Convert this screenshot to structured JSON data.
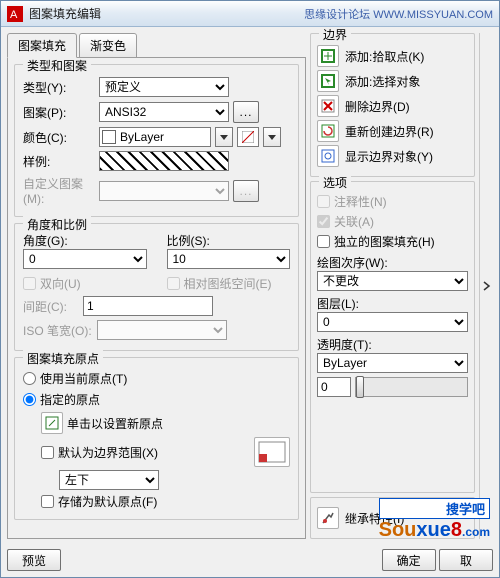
{
  "title": "图案填充编辑",
  "watermark": "思缘设计论坛 WWW.MISSYUAN.COM",
  "tabs": {
    "fill": "图案填充",
    "grad": "渐变色"
  },
  "typeGroup": {
    "title": "类型和图案",
    "type_lbl": "类型(Y):",
    "type_val": "预定义",
    "pat_lbl": "图案(P):",
    "pat_val": "ANSI32",
    "color_lbl": "颜色(C):",
    "color_val": "ByLayer",
    "sample_lbl": "样例:",
    "custom_lbl": "自定义图案(M):"
  },
  "angleGroup": {
    "title": "角度和比例",
    "angle_lbl": "角度(G):",
    "angle_val": "0",
    "scale_lbl": "比例(S):",
    "scale_val": "10",
    "double": "双向(U)",
    "paper": "相对图纸空间(E)",
    "spacing_lbl": "间距(C):",
    "spacing_val": "1",
    "isopen_lbl": "ISO 笔宽(O):"
  },
  "originGroup": {
    "title": "图案填充原点",
    "use_current": "使用当前原点(T)",
    "specified": "指定的原点",
    "click_new": "单击以设置新原点",
    "default_ext": "默认为边界范围(X)",
    "ext_val": "左下",
    "store": "存储为默认原点(F)"
  },
  "boundary": {
    "title": "边界",
    "add_pick": "添加:拾取点(K)",
    "add_sel": "添加:选择对象",
    "del": "删除边界(D)",
    "recreate": "重新创建边界(R)",
    "view": "显示边界对象(Y)"
  },
  "options": {
    "title": "选项",
    "annot": "注释性(N)",
    "assoc": "关联(A)",
    "indep": "独立的图案填充(H)",
    "draworder_lbl": "绘图次序(W):",
    "draworder_val": "不更改",
    "layer_lbl": "图层(L):",
    "layer_val": "0",
    "trans_lbl": "透明度(T):",
    "trans_val": "ByLayer",
    "trans_slider": "0"
  },
  "inherit": "继承特性(I)",
  "footer": {
    "preview": "预览",
    "ok": "确定",
    "cancel": "取"
  },
  "logo": "搜学吧"
}
